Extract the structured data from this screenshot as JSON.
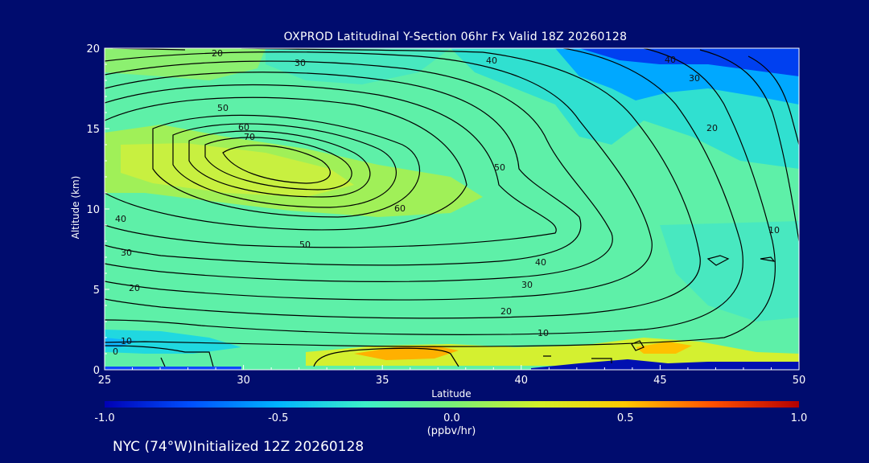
{
  "title": "OXPROD Latitudinal Y-Section 06hr  Fx Valid 18Z 20260128",
  "footer": "NYC (74°W)Initialized 12Z 20260128",
  "chart_data": {
    "type": "heatmap",
    "title": "OXPROD Latitudinal Y-Section 06hr  Fx Valid 18Z 20260128",
    "xlabel": "Latitude",
    "ylabel": "Altitude (km)",
    "xlim": [
      25,
      50
    ],
    "ylim": [
      0,
      20
    ],
    "x_ticks": [
      "25",
      "30",
      "35",
      "40",
      "45",
      "50"
    ],
    "y_ticks": [
      "0",
      "5",
      "10",
      "15",
      "20"
    ],
    "colorbar": {
      "label": "(ppbv/hr)",
      "range": [
        -1.0,
        1.0
      ],
      "ticks": [
        "-1.0",
        "-0.5",
        "0.0",
        "0.5",
        "1.0"
      ],
      "colors": [
        "#0000b4",
        "#0050ff",
        "#00b4ff",
        "#3cf0c8",
        "#78f078",
        "#d2f028",
        "#ffc800",
        "#ff5000",
        "#b40000"
      ]
    },
    "contour_levels": [
      0,
      10,
      20,
      30,
      40,
      50,
      60,
      70
    ],
    "contour_labels": [
      "0",
      "10",
      "20",
      "30",
      "40",
      "50",
      "60",
      "70"
    ],
    "field_samples": {
      "altitudes": [
        20,
        18,
        15,
        12.5,
        10,
        7,
        4,
        2,
        0.8,
        0.2
      ],
      "latitudes": [
        25,
        30,
        35,
        40,
        45,
        50
      ],
      "values": [
        [
          0.1,
          0.05,
          0.0,
          -0.05,
          -0.5,
          -0.8
        ],
        [
          0.15,
          0.05,
          0.0,
          -0.05,
          -0.35,
          -0.6
        ],
        [
          0.25,
          0.15,
          0.05,
          0.0,
          -0.15,
          -0.25
        ],
        [
          0.3,
          0.25,
          0.15,
          0.05,
          0.0,
          -0.05
        ],
        [
          0.2,
          0.2,
          0.2,
          0.1,
          0.05,
          0.05
        ],
        [
          0.1,
          0.1,
          0.1,
          0.05,
          0.1,
          0.1
        ],
        [
          0.05,
          0.1,
          0.1,
          0.1,
          0.05,
          0.1
        ],
        [
          -0.25,
          0.05,
          0.1,
          0.1,
          0.1,
          0.1
        ],
        [
          0.1,
          0.2,
          0.55,
          0.3,
          0.4,
          0.2
        ],
        [
          0.1,
          0.2,
          0.5,
          0.3,
          -0.6,
          -0.6
        ]
      ]
    }
  }
}
